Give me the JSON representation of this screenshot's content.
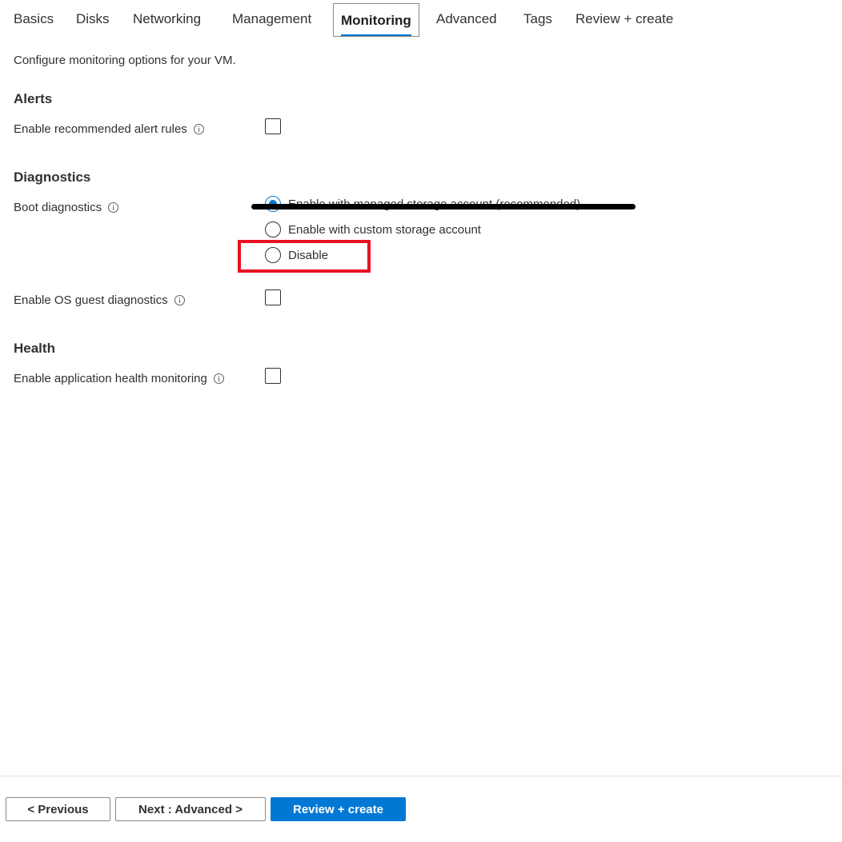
{
  "tabs": [
    {
      "label": "Basics"
    },
    {
      "label": "Disks"
    },
    {
      "label": "Networking"
    },
    {
      "label": "Management"
    },
    {
      "label": "Monitoring",
      "active": true
    },
    {
      "label": "Advanced"
    },
    {
      "label": "Tags"
    },
    {
      "label": "Review + create"
    }
  ],
  "subtitle": "Configure monitoring options for your VM.",
  "alerts": {
    "title": "Alerts",
    "recommended_rules_label": "Enable recommended alert rules",
    "recommended_rules_checked": false
  },
  "diagnostics": {
    "title": "Diagnostics",
    "boot_label": "Boot diagnostics",
    "boot_options": [
      {
        "label": "Enable with managed storage account (recommended)",
        "checked": true
      },
      {
        "label": "Enable with custom storage account",
        "checked": false
      },
      {
        "label": "Disable",
        "checked": false
      }
    ],
    "os_guest_label": "Enable OS guest diagnostics",
    "os_guest_checked": false
  },
  "health": {
    "title": "Health",
    "app_health_label": "Enable application health monitoring",
    "app_health_checked": false
  },
  "footer": {
    "previous_label": "< Previous",
    "next_label": "Next : Advanced >",
    "review_label": "Review + create"
  },
  "colors": {
    "accent": "#0078d4",
    "highlight": "#e81123",
    "text": "#323130"
  }
}
